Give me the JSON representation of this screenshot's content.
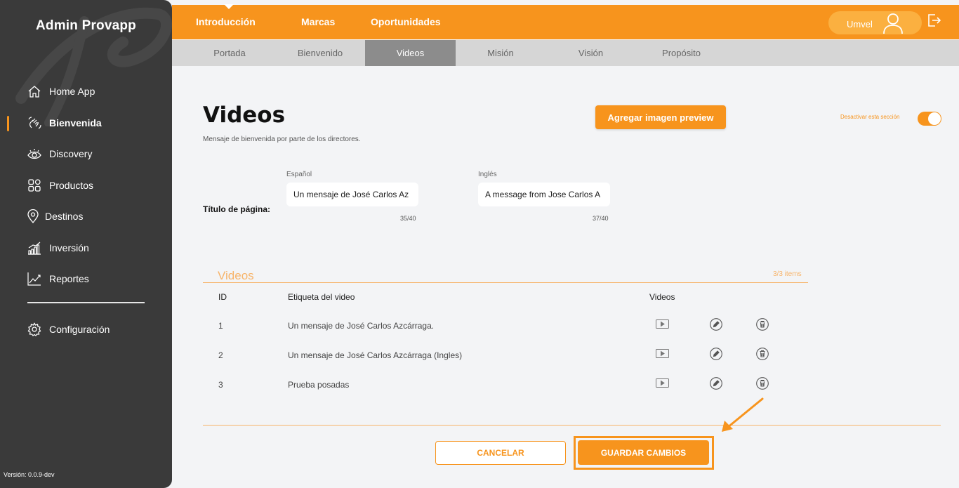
{
  "app": {
    "brand": "Admin Provapp",
    "version": "Versión: 0.0.9-dev"
  },
  "sidebar": {
    "items": [
      {
        "label": "Home App",
        "icon": "home-icon"
      },
      {
        "label": "Bienvenida",
        "icon": "wave-hand-icon",
        "active": true
      },
      {
        "label": "Discovery",
        "icon": "eye-icon"
      },
      {
        "label": "Productos",
        "icon": "grid-icon"
      },
      {
        "label": "Destinos",
        "icon": "location-pin-icon"
      },
      {
        "label": "Inversión",
        "icon": "bar-chart-icon"
      },
      {
        "label": "Reportes",
        "icon": "line-chart-icon"
      }
    ],
    "config": {
      "label": "Configuración",
      "icon": "gear-icon"
    }
  },
  "topnav": {
    "tabs": [
      {
        "label": "Introducción",
        "active": true
      },
      {
        "label": "Marcas"
      },
      {
        "label": "Oportunidades"
      }
    ],
    "user": "Umvel"
  },
  "subnav": {
    "tabs": [
      {
        "label": "Portada"
      },
      {
        "label": "Bienvenido"
      },
      {
        "label": "Videos",
        "active": true
      },
      {
        "label": "Misión"
      },
      {
        "label": "Visión"
      },
      {
        "label": "Propósito"
      }
    ]
  },
  "main": {
    "title": "Videos",
    "subtitle": "Mensaje de bienvenida por parte de los directores.",
    "preview_button": "Agregar imagen preview",
    "toggle_label": "Desactivar esta sección",
    "toggle_on": true,
    "page_title_label": "Título de página:",
    "fields": [
      {
        "lang": "Español",
        "value": "Un mensaje de José Carlos Az",
        "counter": "35/40"
      },
      {
        "lang": "Inglés",
        "value": "A message from Jose Carlos A",
        "counter": "37/40"
      }
    ],
    "videos": {
      "section_title": "Videos",
      "count": "3/3 items",
      "headers": {
        "id": "ID",
        "label": "Etiqueta del video",
        "videos": "Videos"
      },
      "rows": [
        {
          "id": "1",
          "label": "Un mensaje de José Carlos Azcárraga."
        },
        {
          "id": "2",
          "label": "Un mensaje de José Carlos Azcárraga (Ingles)"
        },
        {
          "id": "3",
          "label": "Prueba posadas"
        }
      ]
    },
    "cancel": "CANCELAR",
    "save": "GUARDAR CAMBIOS"
  },
  "colors": {
    "accent": "#f7941d",
    "sidebar": "#3a3a3a",
    "subbar": "#d6d6d6",
    "subbar_active": "#8c8c8c"
  }
}
